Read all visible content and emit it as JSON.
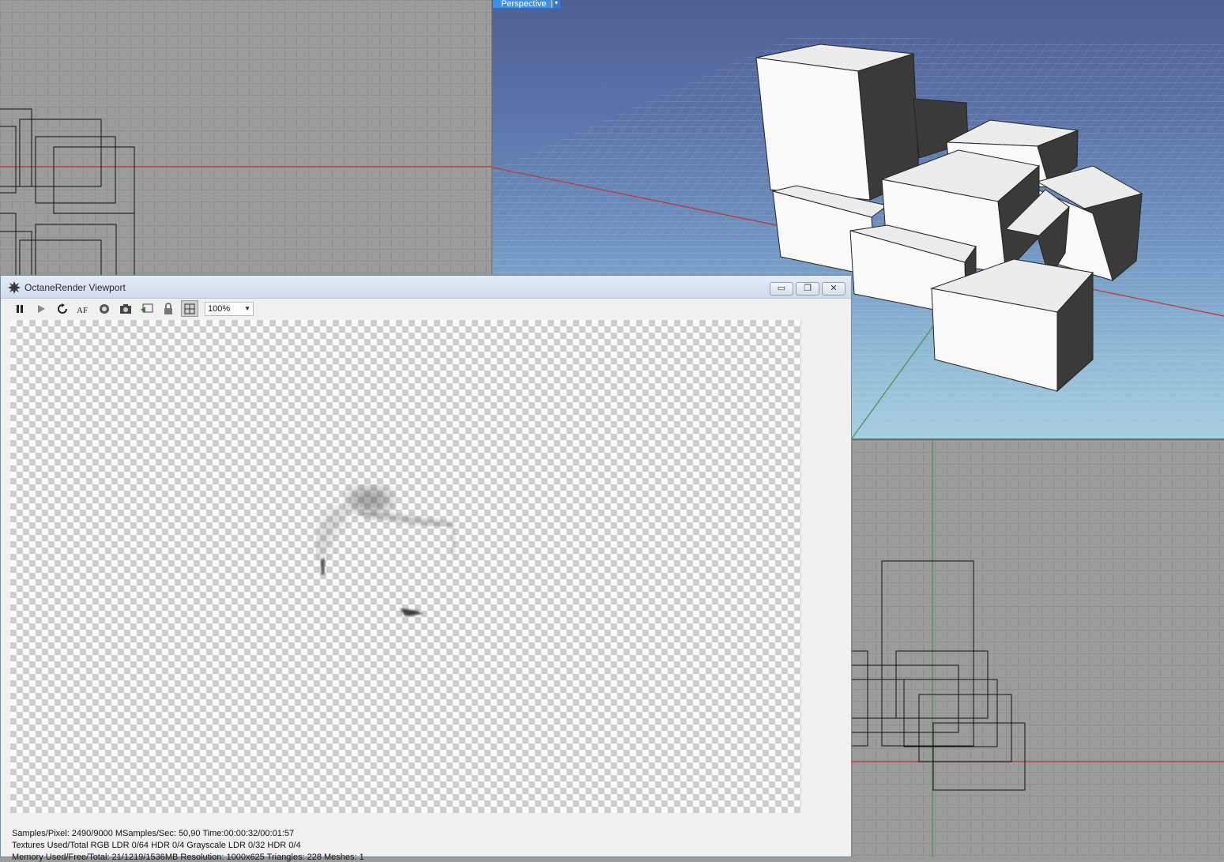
{
  "viewports": {
    "perspective_label": "Perspective"
  },
  "octane": {
    "title": "OctaneRender Viewport",
    "zoom": "100%",
    "status_lines": [
      "Samples/Pixel: 2490/9000  MSamples/Sec: 50,90  Time:00:00:32/00:01:57",
      "Textures Used/Total RGB LDR 0/64  HDR 0/4  Grayscale LDR 0/32  HDR 0/4",
      "Memory Used/Free/Total: 21/1219/1536MB  Resolution: 1000x625  Triangles: 228  Meshes: 1"
    ],
    "toolbar_icons": [
      "pause-icon",
      "play-icon",
      "restart-icon",
      "focus-picker-icon",
      "camera-settings-icon",
      "snapshot-icon",
      "export-icon",
      "lock-icon",
      "region-icon"
    ]
  },
  "colors": {
    "x_axis": "#c0332f",
    "y_axis": "#3a9a3a",
    "viewport_bg": "#9c9c9c",
    "persp_top": "#4e5f95",
    "persp_bottom": "#a6cde0"
  }
}
